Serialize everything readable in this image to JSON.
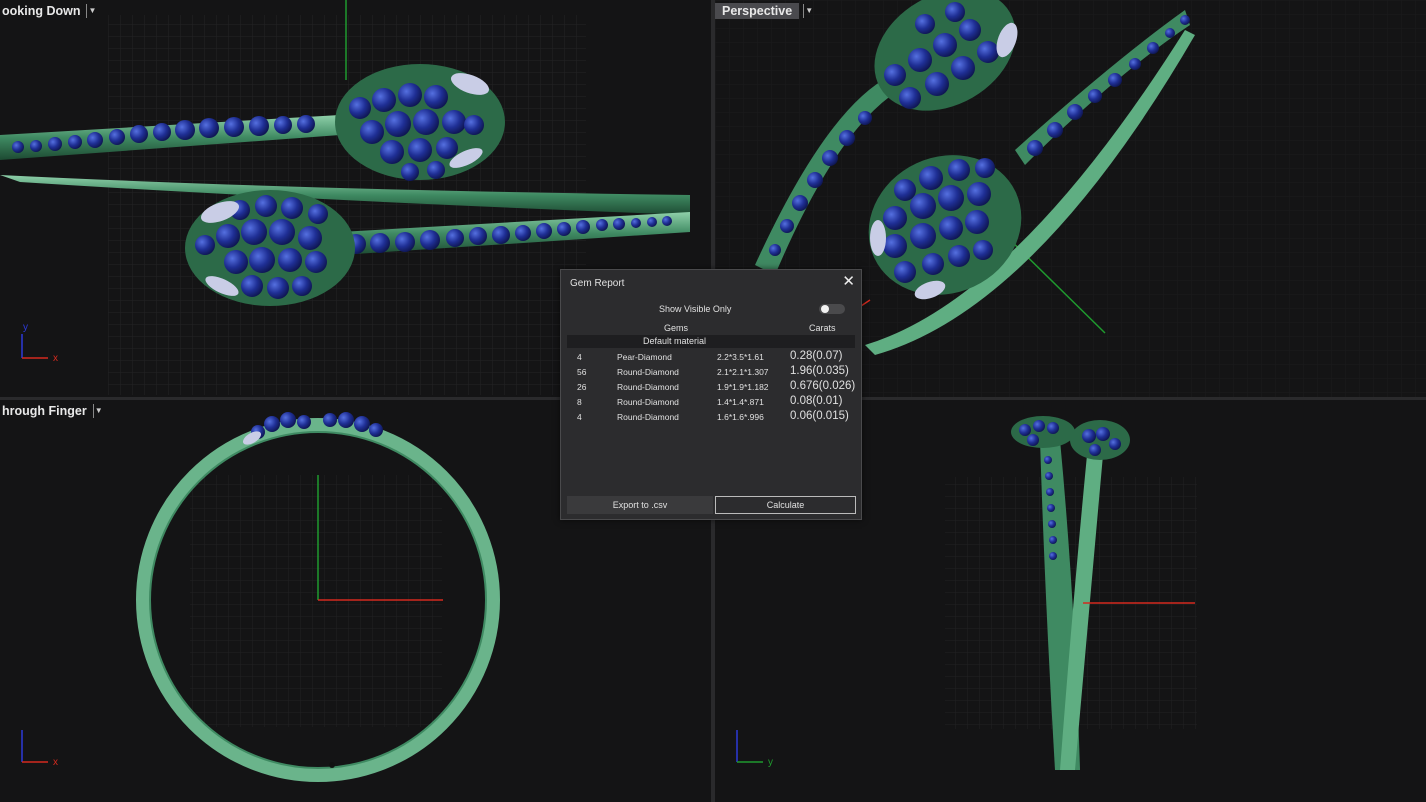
{
  "viewports": {
    "top_left": {
      "title": "ooking Down",
      "axis_labels": {
        "y": "y",
        "x": "x"
      }
    },
    "top_right": {
      "title": "Perspective"
    },
    "bottom_left": {
      "title": "hrough Finger",
      "axis_labels": {
        "x": "x"
      }
    },
    "bottom_right": {
      "axis_labels": {
        "y": "y"
      }
    }
  },
  "dialog": {
    "title": "Gem Report",
    "close_icon": "close-icon",
    "show_visible_only_label": "Show Visible Only",
    "show_visible_only_on": false,
    "columns": {
      "gems": "Gems",
      "carats": "Carats"
    },
    "material": "Default material",
    "rows": [
      {
        "count": "4",
        "name": "Pear-Diamond",
        "size": "2.2*3.5*1.61",
        "carats": "0.28(0.07)"
      },
      {
        "count": "56",
        "name": "Round-Diamond",
        "size": "2.1*2.1*1.307",
        "carats": "1.96(0.035)"
      },
      {
        "count": "26",
        "name": "Round-Diamond",
        "size": "1.9*1.9*1.182",
        "carats": "0.676(0.026)"
      },
      {
        "count": "8",
        "name": "Round-Diamond",
        "size": "1.4*1.4*.871",
        "carats": "0.08(0.01)"
      },
      {
        "count": "4",
        "name": "Round-Diamond",
        "size": "1.6*1.6*.996",
        "carats": "0.06(0.015)"
      }
    ],
    "export_label": "Export to .csv",
    "calculate_label": "Calculate"
  },
  "colors": {
    "metal": "#3f8a62",
    "metal_light": "#7fc49c",
    "gem": "#1f2f95",
    "gem_highlight": "#4a63d8",
    "pear_gem": "#c9cde6",
    "axis_x": "#d42a1e",
    "axis_y": "#1f9a2e",
    "axis_z": "#2d3ad8",
    "grid": "#242426"
  }
}
